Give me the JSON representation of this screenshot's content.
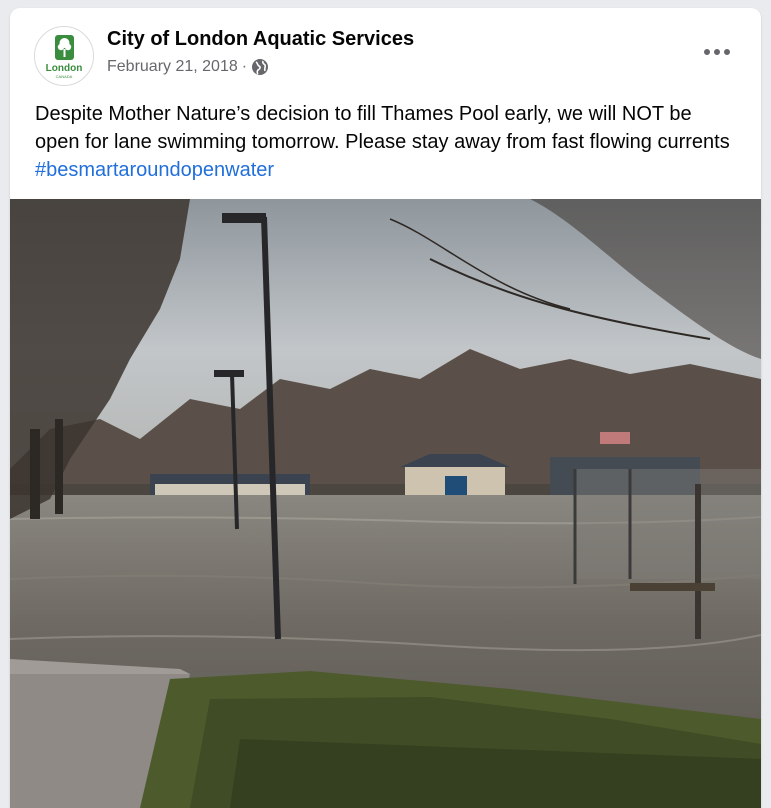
{
  "post": {
    "page_name": "City of London Aquatic Services",
    "date": "February 21, 2018",
    "separator": "·",
    "privacy_icon": "globe-icon",
    "more_icon": "more-options-icon",
    "text": "Despite Mother Nature’s decision to fill Thames Pool early, we will NOT be open for lane swimming tomorrow.  Please stay away from fast flowing currents ",
    "hashtag": "#besmartaroundopenwater",
    "avatar_text": "London",
    "avatar_subtext": "CANADA"
  },
  "colors": {
    "text": "#050505",
    "secondary": "#65676b",
    "link": "#216fdb",
    "logo_green": "#3a8d3f"
  }
}
